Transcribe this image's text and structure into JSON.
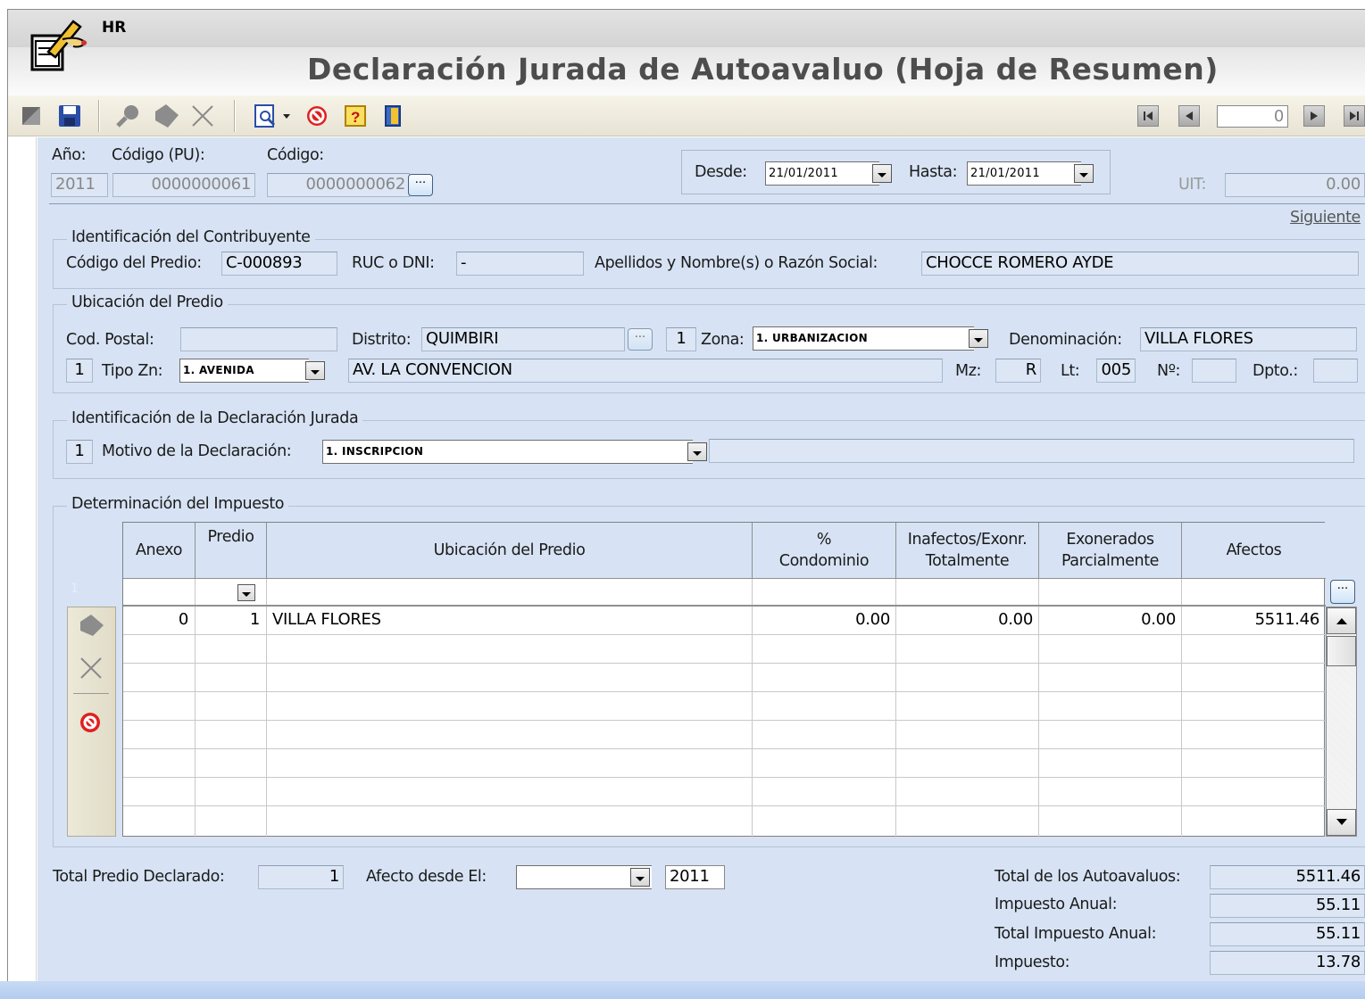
{
  "app": {
    "short_label": "HR",
    "title": "Declaración Jurada de Autoavaluo (Hoja de Resumen)"
  },
  "toolbar": {
    "icons": [
      "new-icon",
      "save-icon",
      "find-icon",
      "tag-icon",
      "delete-icon",
      "preview-icon",
      "dropdown-arrow",
      "cancel-icon",
      "help-icon",
      "exit-icon"
    ],
    "nav": {
      "record_number": "0"
    }
  },
  "header": {
    "anio_label": "Año:",
    "anio_value": "2011",
    "codigo_pu_label": "Código (PU):",
    "codigo_pu_value": "0000000061",
    "codigo_label": "Código:",
    "codigo_value": "0000000062",
    "desde_label": "Desde:",
    "desde_value": "21/01/2011",
    "hasta_label": "Hasta:",
    "hasta_value": "21/01/2011",
    "uit_label": "UIT:",
    "uit_value": "0.00",
    "siguiente_link": "Siguiente"
  },
  "contribuyente": {
    "group_title": "Identificación del Contribuyente",
    "codigo_predio_label": "Código del Predio:",
    "codigo_predio_value": "C-000893",
    "ruc_label": "RUC o DNI:",
    "ruc_value": "-",
    "nombre_label": "Apellidos y Nombre(s) o Razón Social:",
    "nombre_value": "CHOCCE ROMERO AYDE"
  },
  "ubicacion": {
    "group_title": "Ubicación del Predio",
    "cod_postal_label": "Cod. Postal:",
    "cod_postal_value": "",
    "distrito_label": "Distrito:",
    "distrito_value": "QUIMBIRI",
    "zona_code": "1",
    "zona_label": "Zona:",
    "zona_value": "1. URBANIZACION",
    "denominacion_label": "Denominación:",
    "denominacion_value": "VILLA FLORES",
    "tipo_zn_code": "1",
    "tipo_zn_label": "Tipo Zn:",
    "tipo_zn_value": "1. AVENIDA",
    "via_value": "AV. LA CONVENCION",
    "mz_label": "Mz:",
    "mz_value": "R",
    "lt_label": "Lt:",
    "lt_value": "005",
    "num_label": "Nº:",
    "num_value": "",
    "dpto_label": "Dpto.:",
    "dpto_value": ""
  },
  "declaracion": {
    "group_title": "Identificación de la Declaración Jurada",
    "motivo_code": "1",
    "motivo_label": "Motivo de la Declaración:",
    "motivo_value": "1. INSCRIPCION",
    "motivo_detail": ""
  },
  "impuesto": {
    "group_title": "Determinación del Impuesto",
    "columns": {
      "anexo": "Anexo",
      "predio": "Predio",
      "ubicacion": "Ubicación del Predio",
      "condominio_1": "%",
      "condominio_2": "Condominio",
      "inafectos_1": "Inafectos/Exonr.",
      "inafectos_2": "Totalmente",
      "exonerados_1": "Exonerados",
      "exonerados_2": "Parcialmente",
      "afectos": "Afectos"
    },
    "new_row_marker": "1",
    "rows": [
      {
        "anexo": "0",
        "predio": "1",
        "ubicacion": "VILLA FLORES",
        "condominio": "0.00",
        "inafectos": "0.00",
        "exonerados": "0.00",
        "afectos": "5511.46"
      }
    ]
  },
  "totales": {
    "total_predio_label": "Total Predio Declarado:",
    "total_predio_value": "1",
    "afecto_desde_label": "Afecto desde El:",
    "afecto_desde_value": "",
    "afecto_anio": "2011",
    "total_autoavaluos_label": "Total de los Autoavaluos:",
    "total_autoavaluos_value": "5511.46",
    "impuesto_anual_label": "Impuesto Anual:",
    "impuesto_anual_value": "55.11",
    "total_impuesto_label": "Total Impuesto Anual:",
    "total_impuesto_value": "55.11",
    "impuesto_label": "Impuesto:",
    "impuesto_value": "13.78"
  },
  "colors": {
    "panel": "#d7e3f4",
    "toolbar": "#ece8d8",
    "field": "#dce6f4",
    "title_text": "#4d4d4d"
  }
}
